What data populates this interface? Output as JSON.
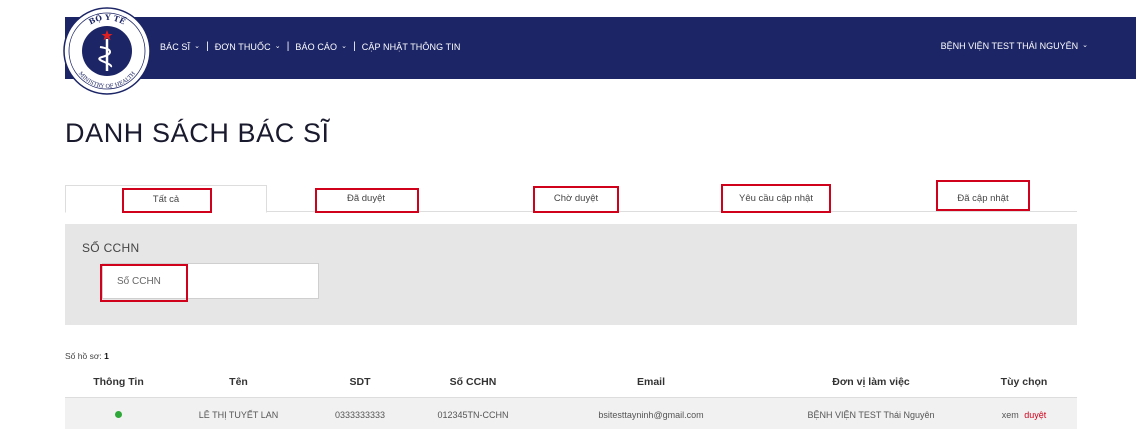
{
  "header": {
    "menu": [
      {
        "label": "BÁC SĨ",
        "has_caret": true
      },
      {
        "label": "ĐƠN THUỐC",
        "has_caret": true
      },
      {
        "label": "BÁO CÁO",
        "has_caret": true
      },
      {
        "label": "CẬP NHẬT THÔNG TIN",
        "has_caret": false
      }
    ],
    "separator": "|",
    "hospital_label": "BỆNH VIỆN TEST THÁI NGUYÊN",
    "caret": "⌄",
    "navbar_color": "#1c2566"
  },
  "logo": {
    "top_text": "BỘ Y TẾ",
    "bottom_text": "MINISTRY OF HEALTH",
    "icon": "caduceus-icon"
  },
  "page": {
    "title": "DANH SÁCH BÁC SĨ"
  },
  "tabs": [
    {
      "label": "Tất cả",
      "active": true
    },
    {
      "label": "Đã duyệt",
      "active": false
    },
    {
      "label": "Chờ duyệt",
      "active": false
    },
    {
      "label": "Yêu cầu cập nhật",
      "active": false
    },
    {
      "label": "Đã cập nhật",
      "active": false
    }
  ],
  "filter": {
    "label": "SỐ CCHN",
    "placeholder": "Số CCHN",
    "value": ""
  },
  "record_count": {
    "label": "Số hồ sơ:",
    "value": "1"
  },
  "table": {
    "headers": [
      "Thông Tin",
      "Tên",
      "SDT",
      "Số CCHN",
      "Email",
      "Đơn vị làm việc",
      "Tùy chọn"
    ],
    "rows": [
      {
        "status": "active",
        "status_color": "#2fa83a",
        "name": "LÊ THỊ TUYẾT LAN",
        "phone": "0333333333",
        "cchn": "012345TN-CCHN",
        "email": "bsitesttayninh@gmail.com",
        "workplace": "BỆNH VIỆN TEST Thái Nguyên",
        "action_view": "xem",
        "action_approve": "duyệt"
      }
    ]
  },
  "highlight_color": "#d0021b"
}
